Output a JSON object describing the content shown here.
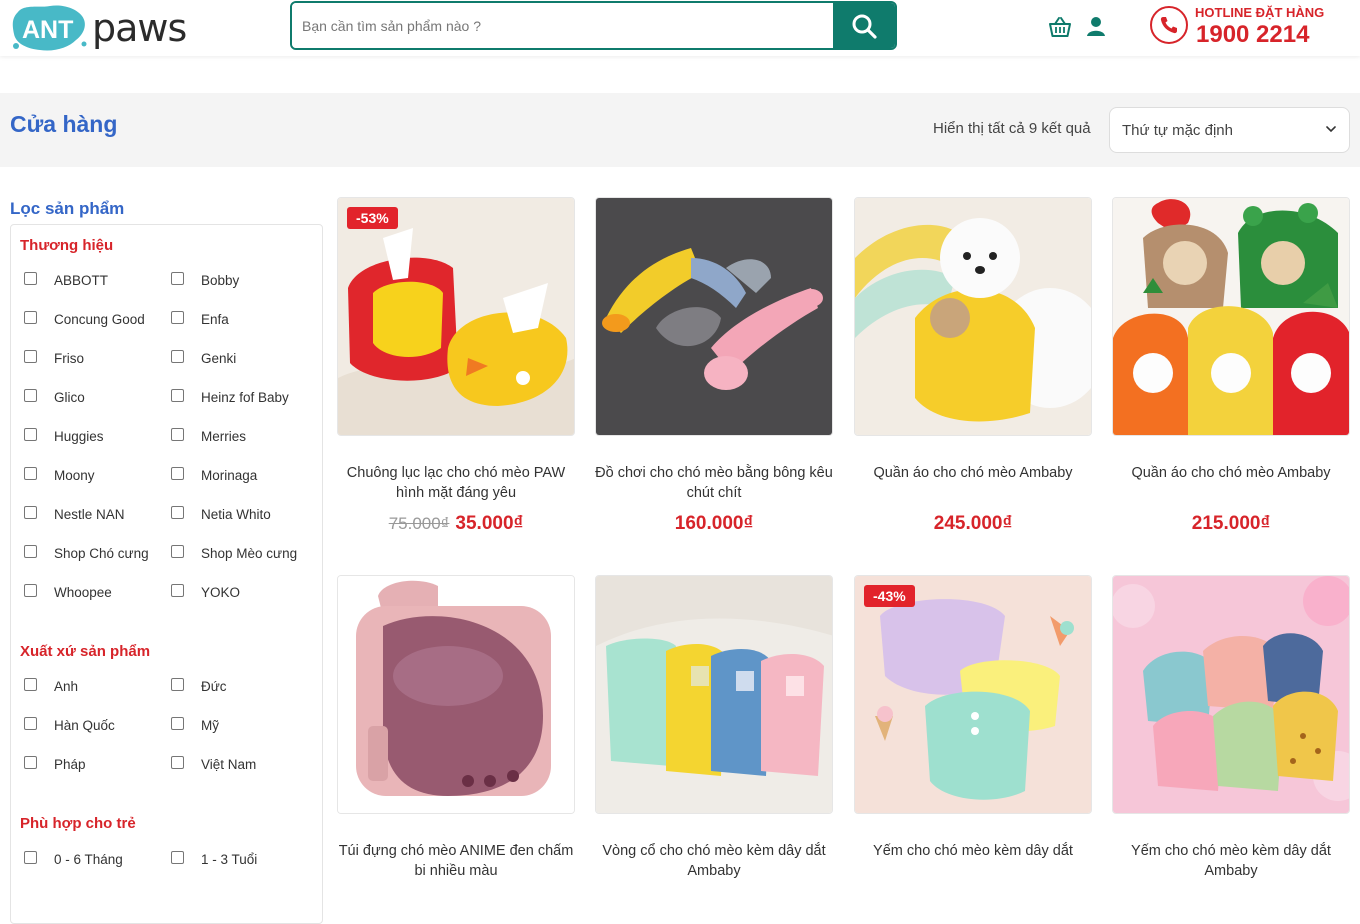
{
  "header": {
    "logo_ant": "ANT",
    "logo_paws": "paws",
    "search_placeholder": "Bạn cần tìm sản phẩm nào ?",
    "hotline_label": "HOTLINE ĐẶT HÀNG",
    "hotline_number": "1900 2214",
    "icons": [
      "basket-icon",
      "user-icon",
      "phone-icon",
      "search-icon"
    ],
    "brand_color": "#0f7b6c",
    "accent_color": "#d7242a"
  },
  "title_band": {
    "title": "Cửa hàng",
    "result_count": "Hiển thị tất cả 9 kết quả",
    "sort_selected": "Thứ tự mặc định"
  },
  "sidebar": {
    "heading": "Lọc sản phẩm",
    "groups": [
      {
        "title": "Thương hiệu",
        "options": [
          "ABBOTT",
          "Bobby",
          "Concung Good",
          "Enfa",
          "Friso",
          "Genki",
          "Glico",
          "Heinz fof Baby",
          "Huggies",
          "Merries",
          "Moony",
          "Morinaga",
          "Nestle NAN",
          "Netia Whito",
          "Shop Chó cưng",
          "Shop Mèo cưng",
          "Whoopee",
          "YOKO"
        ]
      },
      {
        "title": "Xuất xứ sản phẩm",
        "options": [
          "Anh",
          "Đức",
          "Hàn Quốc",
          "Mỹ",
          "Pháp",
          "Việt Nam"
        ]
      },
      {
        "title": "Phù hợp cho trẻ",
        "options": [
          "0 - 6 Tháng",
          "1 - 3 Tuổi"
        ]
      }
    ]
  },
  "products": [
    {
      "name": "Chuông lục lạc cho chó mèo PAW hình mặt đáng yêu",
      "badge": "-53%",
      "old_price": "75.000₫",
      "price": "35.000₫"
    },
    {
      "name": "Đồ chơi cho chó mèo bằng bông kêu chút chít",
      "badge": "",
      "old_price": "",
      "price": "160.000₫"
    },
    {
      "name": "Quần áo cho chó mèo Ambaby",
      "badge": "",
      "old_price": "",
      "price": "245.000₫"
    },
    {
      "name": "Quần áo cho chó mèo Ambaby",
      "badge": "",
      "old_price": "",
      "price": "215.000₫"
    },
    {
      "name": "Túi đựng chó mèo ANIME đen chấm bi nhiều màu",
      "badge": "",
      "old_price": "",
      "price": ""
    },
    {
      "name": "Vòng cổ cho chó mèo kèm dây dắt Ambaby",
      "badge": "",
      "old_price": "",
      "price": ""
    },
    {
      "name": "Yếm cho chó mèo kèm dây dắt",
      "badge": "-43%",
      "old_price": "",
      "price": ""
    },
    {
      "name": "Yếm cho chó mèo kèm dây dắt Ambaby",
      "badge": "",
      "old_price": "",
      "price": ""
    }
  ]
}
